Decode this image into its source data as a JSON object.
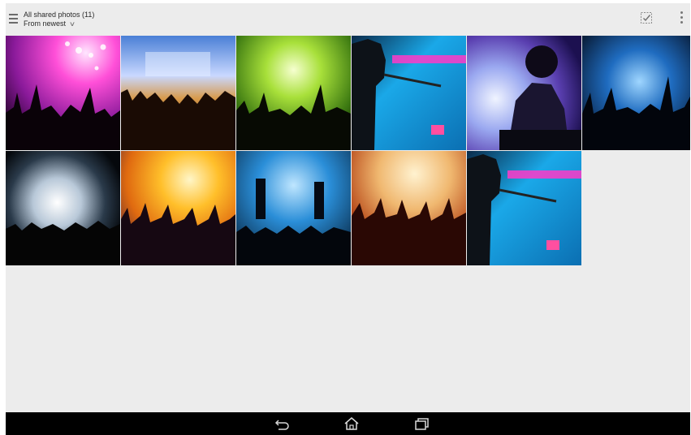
{
  "header": {
    "title": "All shared photos (11)",
    "sort_label": "From newest"
  },
  "colors": {
    "background": "#ececec",
    "navbar": "#000000"
  },
  "icons": {
    "menu": "hamburger-menu-icon",
    "sort": "chevron-down-icon",
    "select": "select-checkbox-icon",
    "more": "more-vertical-icon",
    "back": "back-icon",
    "home": "home-icon",
    "recents": "recent-apps-icon"
  },
  "photos": [
    {
      "name": "photo-concert-pink-lights"
    },
    {
      "name": "photo-concert-stage-crowd"
    },
    {
      "name": "photo-concert-green-lights"
    },
    {
      "name": "photo-singer-microphone-blue"
    },
    {
      "name": "photo-dj-headphones"
    },
    {
      "name": "photo-concert-blue-stage"
    },
    {
      "name": "photo-concert-white-spotlight"
    },
    {
      "name": "photo-concert-golden-rays"
    },
    {
      "name": "photo-band-blue-stage"
    },
    {
      "name": "photo-crowd-sunset-glow"
    },
    {
      "name": "photo-singer-microphone-blue-2"
    }
  ]
}
